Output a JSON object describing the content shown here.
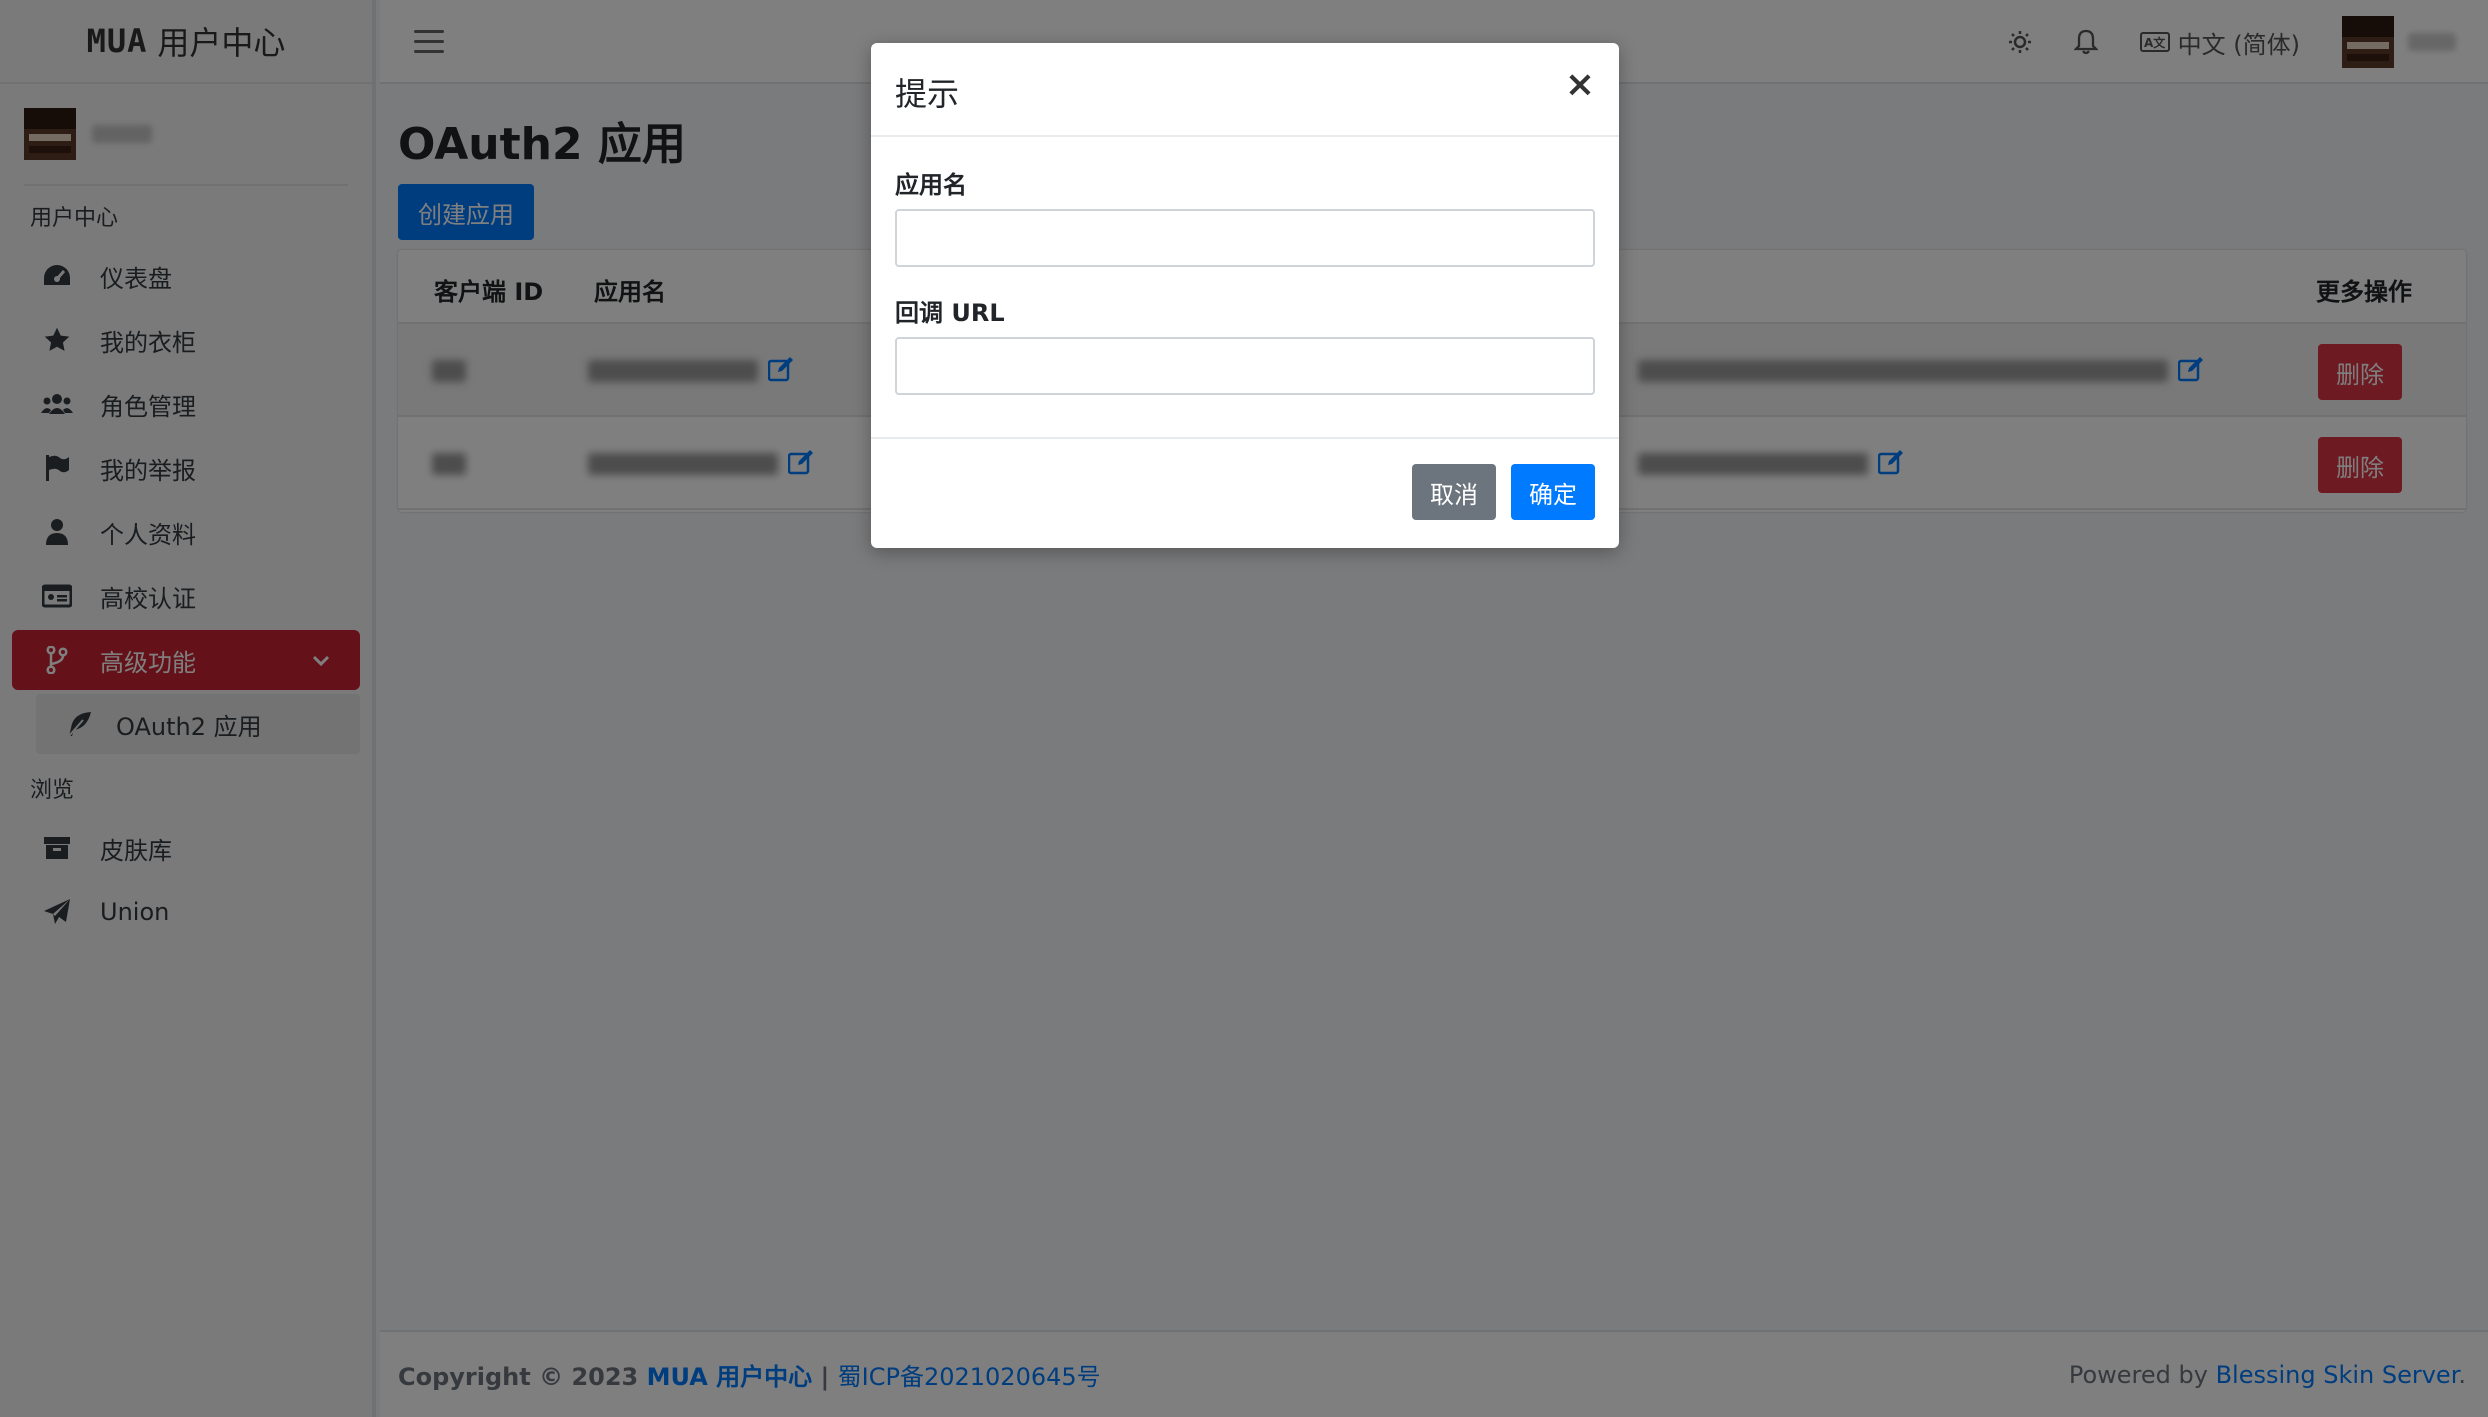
{
  "brand": {
    "logo": "MUA",
    "name": "用户中心"
  },
  "sidebar": {
    "section_user": "用户中心",
    "items": [
      {
        "label": "仪表盘",
        "icon": "dashboard-icon"
      },
      {
        "label": "我的衣柜",
        "icon": "star-icon"
      },
      {
        "label": "角色管理",
        "icon": "users-icon"
      },
      {
        "label": "我的举报",
        "icon": "flag-icon"
      },
      {
        "label": "个人资料",
        "icon": "user-icon"
      },
      {
        "label": "高校认证",
        "icon": "id-card-icon"
      },
      {
        "label": "高级功能",
        "icon": "code-branch-icon"
      }
    ],
    "sub_item": {
      "label": "OAuth2 应用",
      "icon": "feather-icon"
    },
    "section_browse": "浏览",
    "browse_items": [
      {
        "label": "皮肤库",
        "icon": "archive-icon"
      },
      {
        "label": "Union",
        "icon": "paper-plane-icon"
      }
    ]
  },
  "topbar": {
    "language": "中文 (简体)",
    "lang_icon_text": "A文"
  },
  "main": {
    "title": "OAuth2 应用",
    "create_button": "创建应用",
    "table": {
      "col_client_id": "客户端 ID",
      "col_app_name": "应用名",
      "col_more": "更多操作",
      "delete_label": "删除"
    }
  },
  "footer": {
    "copyright": "Copyright © 2023 ",
    "site_link": "MUA 用户中心",
    "sep": " | ",
    "icp": "蜀ICP备2021020645号",
    "powered": "Powered by ",
    "powered_link": "Blessing Skin Server",
    "period": "."
  },
  "modal": {
    "title": "提示",
    "close": "×",
    "field_name_label": "应用名",
    "field_name_value": "",
    "field_url_label": "回调 URL",
    "field_url_value": "",
    "cancel": "取消",
    "ok": "确定"
  }
}
